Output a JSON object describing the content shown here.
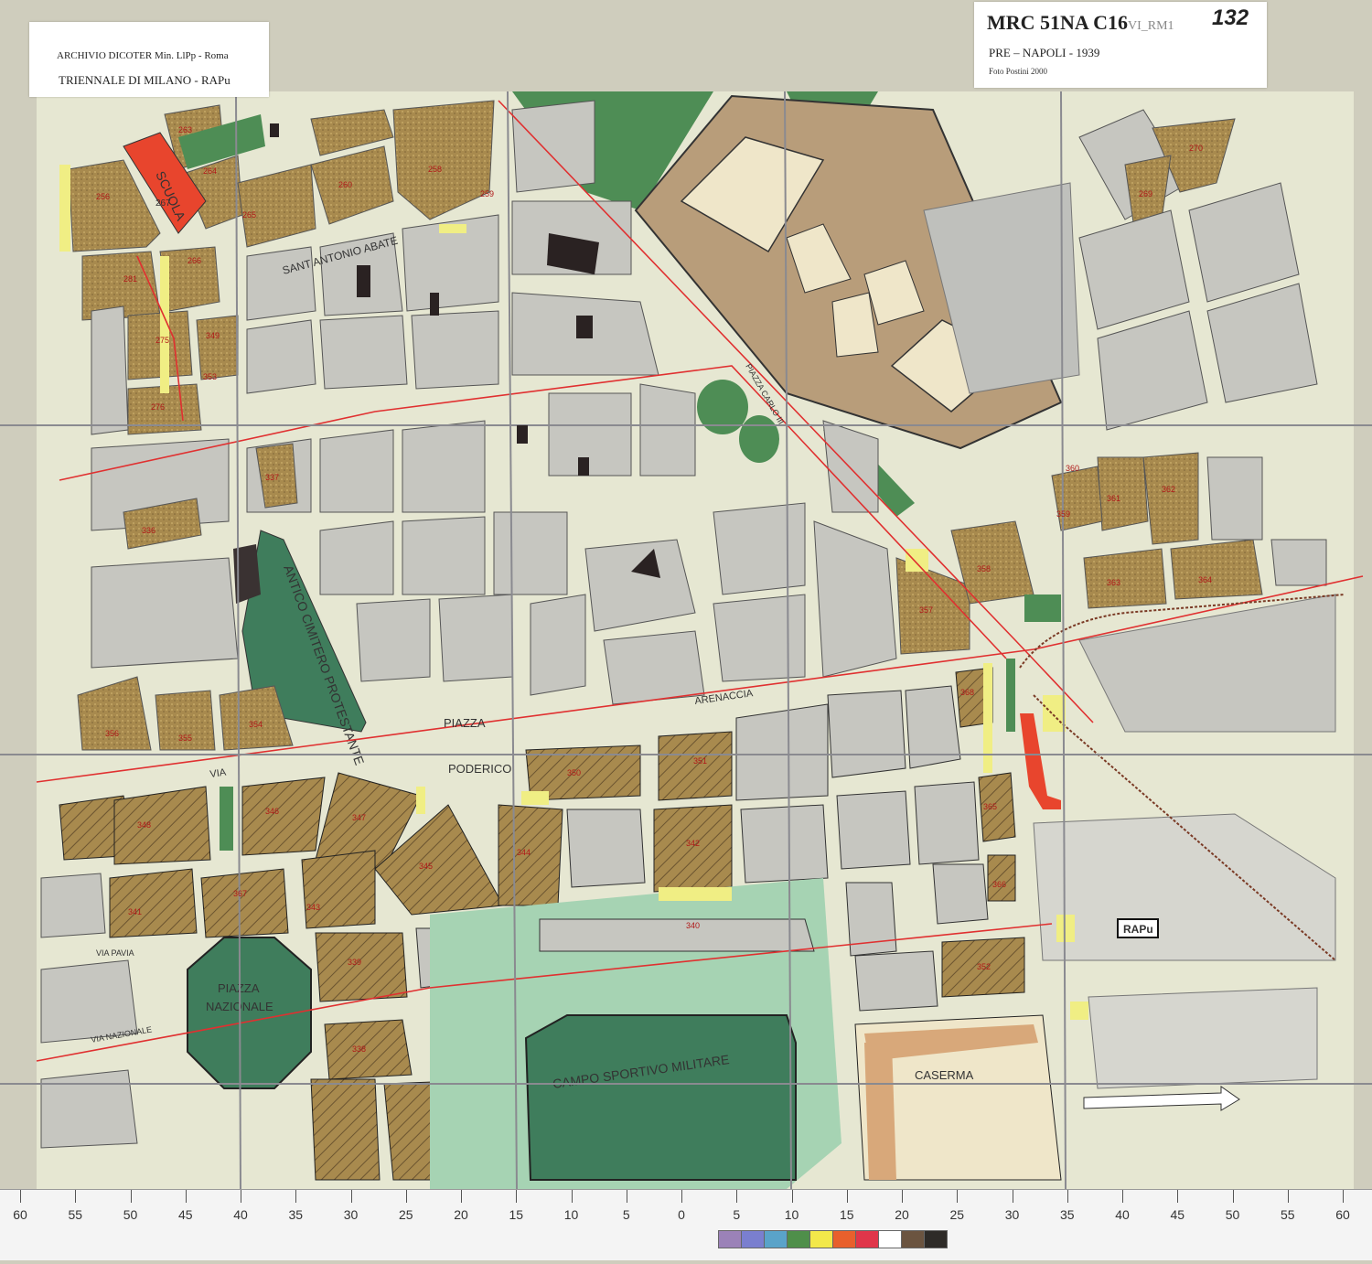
{
  "archive_card": {
    "line1": "ARCHIVIO DICOTER Min. LlPp - Roma",
    "line2": "TRIENNALE DI MILANO - RAPu"
  },
  "id_card": {
    "code": "MRC 51NA C16",
    "code_suffix": "VI_RM1",
    "number": "132",
    "title": "PRE – NAPOLI - 1939",
    "photo": "Foto Postini 2000"
  },
  "map_labels": {
    "school": "SCUOLA",
    "school_num": "267",
    "cemetery": "ANTICO CIMITERO PROTESTANTE",
    "piazza": "PIAZZA",
    "poderico": "PODERICO",
    "piazza_nazionale_1": "PIAZZA",
    "piazza_nazionale_2": "NAZIONALE",
    "campo": "CAMPO SPORTIVO MILITARE",
    "caserma": "CASERMA",
    "rapu": "RAPu",
    "santantonio": "SANT ANTONIO ABATE",
    "carlo_iii": "PIAZZA CARLO III",
    "via_pavia": "VIA PAVIA",
    "via_nazionale": "VIA NAZIONALE",
    "via": "VIA",
    "arenaccia": "ARENACCIA"
  },
  "block_numbers": [
    "263",
    "264",
    "258",
    "259",
    "260",
    "265",
    "256",
    "266",
    "281",
    "275",
    "349",
    "353",
    "276",
    "270",
    "269",
    "357",
    "336",
    "360",
    "361",
    "362",
    "358",
    "359",
    "363",
    "364",
    "356",
    "355",
    "354",
    "350",
    "351",
    "348",
    "346",
    "347",
    "345",
    "344",
    "342",
    "341",
    "343",
    "340",
    "339",
    "338",
    "352",
    "337",
    "368",
    "365",
    "366",
    "367"
  ],
  "ruler": {
    "ticks": [
      "60",
      "55",
      "50",
      "45",
      "40",
      "35",
      "30",
      "25",
      "20",
      "15",
      "10",
      "5",
      "0",
      "5",
      "10",
      "15",
      "20",
      "25",
      "30",
      "35",
      "40",
      "45",
      "50",
      "55",
      "60"
    ]
  },
  "color_strip": [
    "#9b82b8",
    "#7a7fcf",
    "#5aa3c9",
    "#4f8f4a",
    "#f2e84a",
    "#e8602c",
    "#e0364a",
    "#ffffff",
    "#6b5440",
    "#2e2b28"
  ],
  "colors": {
    "road": "#e6e7d2",
    "block_grey": "#c6c6c0",
    "block_brown": "#a88a4e",
    "park_green": "#4e8d55",
    "cemetery_green": "#3f7d5c",
    "school_red": "#e8452d",
    "yellow_strip": "#f0ee84",
    "barracks_tan": "#d8a87a",
    "red_line": "#e03030"
  }
}
